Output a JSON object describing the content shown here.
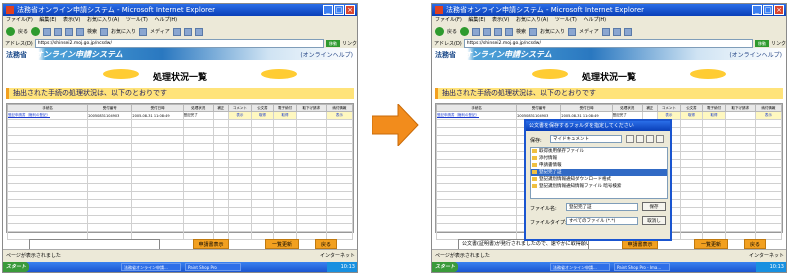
{
  "shots": [
    {
      "title": "法務省オンライン申請システム - Microsoft Internet Explorer",
      "menu": [
        "ファイル(F)",
        "編集(E)",
        "表示(V)",
        "お気に入り(A)",
        "ツール(T)",
        "ヘルプ(H)"
      ],
      "toolbar": {
        "back": "戻る",
        "search": "検索",
        "favorites": "お気に入り",
        "media": "メディア"
      },
      "address_label": "アドレス(D)",
      "address_url": "https://shinsei2.moj.go.jp/ncsdw/",
      "go_label": "移動",
      "links_label": "リンク",
      "site": {
        "org": "法務省",
        "system": "オンライン申請システム",
        "help": "(オンラインヘルプ)"
      },
      "page_title": "処理状況一覧",
      "message": "抽出された手続の処理状況は、以下のとおりです",
      "table": {
        "headers": [
          "手続名",
          "受付番号",
          "受付日時",
          "処理状況",
          "補正",
          "コメント",
          "公文書",
          "電子納付",
          "取下げ請求",
          "納付情報"
        ],
        "rows": [
          [
            "登記申請書（権利の登記）",
            "20050831104903",
            "2005-08-31 11:08:49",
            "登記完了",
            "",
            "表示",
            "取得",
            "取得",
            "",
            "表示"
          ]
        ]
      },
      "bottom": {
        "notice": "",
        "buttons": [
          "申請書表示",
          "一覧更新",
          "戻る"
        ]
      },
      "status": "ページが表示されました",
      "status_zone": "インターネット",
      "taskbar": {
        "start": "スタート",
        "tasks": [
          "法務省オンライン申請...",
          "Paint Shop Pro"
        ],
        "clock": "10:13"
      }
    },
    {
      "title": "法務省オンライン申請システム - Microsoft Internet Explorer",
      "menu": [
        "ファイル(F)",
        "編集(E)",
        "表示(V)",
        "お気に入り(A)",
        "ツール(T)",
        "ヘルプ(H)"
      ],
      "toolbar": {
        "back": "戻る",
        "search": "検索",
        "favorites": "お気に入り",
        "media": "メディア"
      },
      "address_label": "アドレス(D)",
      "address_url": "https://shinsei2.moj.go.jp/ncsdw/",
      "go_label": "移動",
      "links_label": "リンク",
      "site": {
        "org": "法務省",
        "system": "オンライン申請システム",
        "help": "(オンラインヘルプ)"
      },
      "page_title": "処理状況一覧",
      "message": "抽出された手続の処理状況は、以下のとおりです",
      "table": {
        "headers": [
          "手続名",
          "受付番号",
          "受付日時",
          "処理状況",
          "補正",
          "コメント",
          "公文書",
          "電子納付",
          "取下げ請求",
          "納付情報"
        ],
        "rows": [
          [
            "登記申請書（権利の登記）",
            "20050831104903",
            "2005-08-31 11:08:49",
            "登記完了",
            "",
            "表示",
            "取得",
            "取得",
            "",
            "表示"
          ]
        ]
      },
      "bottom": {
        "notice": "公文書(証明書)が発行されましたので、速やかに取得願います。",
        "buttons": [
          "申請書表示",
          "一覧更新",
          "戻る"
        ]
      },
      "status": "ページが表示されました",
      "status_zone": "インターネット",
      "taskbar": {
        "start": "スタート",
        "tasks": [
          "法務省オンライン申請...",
          "Paint Shop Pro - Ima..."
        ],
        "clock": "10:13"
      },
      "dialog": {
        "title": "公文書を保存するフォルダを指定してください",
        "lookin_label": "保存:",
        "lookin_value": "マイドキュメント",
        "items": [
          "取得後用保存ファイル",
          "添付情報",
          "申請書情報",
          "登記完了証",
          "登記識別情報通知ダウンロード格式",
          "登記識別情報通知情報ファイル 暗号検索"
        ],
        "selected_index": 3,
        "filename_label": "ファイル名:",
        "filename_value": "登記完了証",
        "filetype_label": "ファイルタイプ:",
        "filetype_value": "すべてのファイル (*.*)",
        "save_button": "保存",
        "cancel_button": "取消し"
      }
    }
  ],
  "arrow": {
    "color": "#f28c1c",
    "direction": "right"
  }
}
